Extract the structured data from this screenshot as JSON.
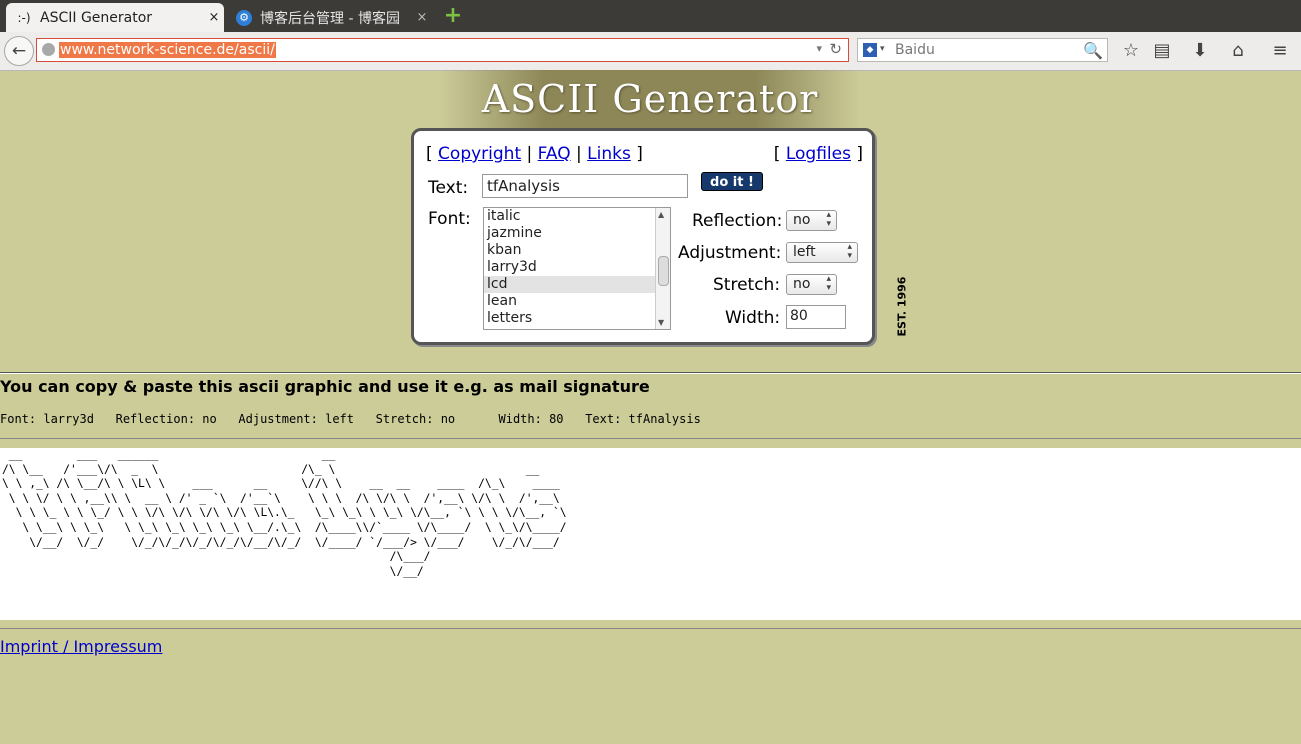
{
  "browser": {
    "tabs": [
      {
        "favicon": ":-)",
        "title": "ASCII Generator",
        "close": "×"
      },
      {
        "favicon": "⚙",
        "title": "博客后台管理 - 博客园",
        "close": "×"
      }
    ],
    "new_tab": "+",
    "back": "←",
    "url": "www.network-science.de/ascii/",
    "url_dropdown": "▾",
    "reload": "↻",
    "search_engine_icon": "paw",
    "search_dropdown": "▾",
    "search_placeholder": "Baidu",
    "search_icon": "🔍",
    "toolbar_icons": {
      "bookmark": "☆",
      "reader": "▤",
      "download": "⬇",
      "home": "⌂",
      "menu": "≡"
    }
  },
  "page": {
    "logo": "ASCII Generator",
    "est": "EST. 1996",
    "links_left": [
      "Copyright",
      "FAQ",
      "Links"
    ],
    "links_right": [
      "Logfiles"
    ],
    "text_label": "Text:",
    "text_value": "tfAnalysis",
    "doit_label": "do it !",
    "font_label": "Font:",
    "fonts": [
      "italic",
      "jazmine",
      "kban",
      "larry3d",
      "lcd",
      "lean",
      "letters"
    ],
    "selected_font": "lcd",
    "reflection_label": "Reflection:",
    "reflection_value": "no",
    "adjustment_label": "Adjustment:",
    "adjustment_value": "left",
    "stretch_label": "Stretch:",
    "stretch_value": "no",
    "width_label": "Width:",
    "width_value": "80",
    "copy_note": "You can copy & paste this ascii graphic and use it e.g. as mail signature",
    "settings_line": "Font: larry3d   Reflection: no   Adjustment: left   Stretch: no      Width: 80   Text: tfAnalysis",
    "ascii_art": " __        ___   ______                        __\n/\\ \\__   /'___\\/\\  _  \\                     /\\_ \\                            __\n\\ \\ ,_\\ /\\ \\__/\\ \\ \\L\\ \\    ___      __     \\//\\ \\    __  __    ____  /\\_\\    ____\n \\ \\ \\/ \\ \\ ,__\\\\ \\  __ \\ /' _ `\\  /'__`\\    \\ \\ \\  /\\ \\/\\ \\  /',__\\ \\/\\ \\  /',__\\\n  \\ \\ \\_ \\ \\ \\_/ \\ \\ \\/\\ \\/\\ \\/\\ \\/\\ \\L\\.\\_   \\_\\ \\_\\ \\ \\_\\ \\/\\__, `\\ \\ \\ \\/\\__, `\\\n   \\ \\__\\ \\ \\_\\   \\ \\_\\ \\_\\ \\_\\ \\_\\ \\__/.\\_\\  /\\____\\\\/`____ \\/\\____/  \\ \\_\\/\\____/\n    \\/__/  \\/_/    \\/_/\\/_/\\/_/\\/_/\\/__/\\/_/  \\/____/ `/___/> \\/___/    \\/_/\\/___/\n                                                         /\\___/\n                                                         \\/__/",
    "imprint": "Imprint / Impressum"
  }
}
